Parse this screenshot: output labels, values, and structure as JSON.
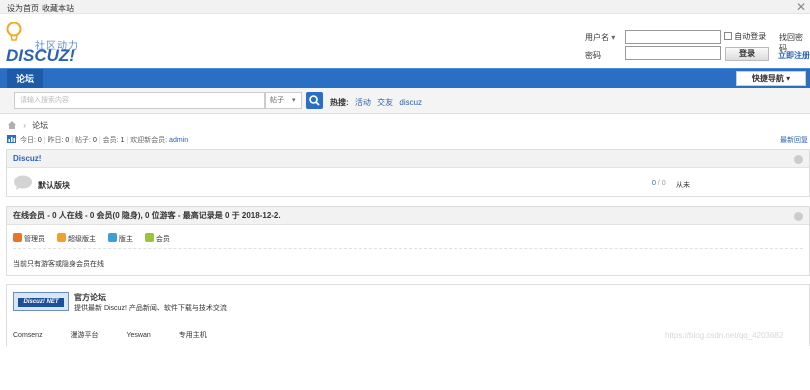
{
  "topbar": {
    "set_home": "设为首页",
    "bookmark": "收藏本站",
    "close": "✕"
  },
  "logo": {
    "slogan": "社区动力",
    "brand": "DISCUZ!"
  },
  "login": {
    "username_select": "用户名",
    "password_label": "密码",
    "auto_login": "自动登录",
    "find_password": "找回密码",
    "login_button": "登录",
    "register": "立即注册"
  },
  "nav": {
    "forum_tab": "论坛",
    "quick_nav": "快捷导航"
  },
  "search": {
    "placeholder": "请输入搜索内容",
    "type": "帖子",
    "hot_label": "热搜:",
    "hot_terms": [
      "活动",
      "交友",
      "discuz"
    ]
  },
  "breadcrumb": {
    "current": "论坛"
  },
  "stats": {
    "today_label": "今日:",
    "today": "0",
    "yesterday_label": "昨日:",
    "yesterday": "0",
    "posts_label": "帖子:",
    "posts": "0",
    "members_label": "会员:",
    "members": "1",
    "newest_label": "欢迎新会员:",
    "newest": "admin",
    "latest_reply": "最新回复"
  },
  "category": {
    "title": "Discuz!",
    "forum_name": "默认版块",
    "threads": "0",
    "posts": "0",
    "last_post": "从未"
  },
  "online": {
    "title": "在线会员 - 0 人在线 - 0 会员(0 隐身), 0 位游客 - 最高记录是 0 于 2018-12-2.",
    "legend": [
      {
        "label": "管理员",
        "color": "#e8732a"
      },
      {
        "label": "超级版主",
        "color": "#f0a030"
      },
      {
        "label": "版主",
        "color": "#3aa0d8"
      },
      {
        "label": "会员",
        "color": "#9bc43c"
      }
    ],
    "notice": "当前只有游客或隐身会员在线"
  },
  "official": {
    "badge": "Discuz! NET",
    "title": "官方论坛",
    "desc": "提供最新 Discuz! 产品新闻、软件下载与技术交流"
  },
  "footer_links": [
    "Comsenz",
    "漫游平台",
    "Yeswan",
    "专用主机"
  ],
  "watermark": "https://blog.csdn.net/qq_4203682"
}
